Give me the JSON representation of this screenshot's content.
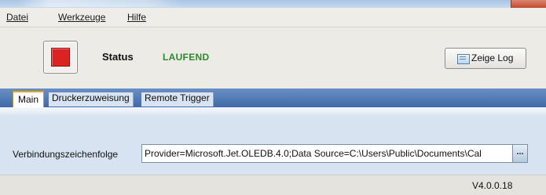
{
  "menu": {
    "items": [
      {
        "label": "Datei"
      },
      {
        "label": "Werkzeuge"
      },
      {
        "label": "Hilfe"
      }
    ]
  },
  "status": {
    "label": "Status",
    "value": "LAUFEND",
    "value_color": "#2c8a2c",
    "stop_color": "#dd2222"
  },
  "toolbar": {
    "log_button_label": "Zeige Log",
    "log_icon": "log-window-icon"
  },
  "tabs": [
    {
      "label": "Main",
      "active": true
    },
    {
      "label": "Druckerzuweisung",
      "active": false
    },
    {
      "label": "Remote Trigger",
      "active": false
    }
  ],
  "connection": {
    "label": "Verbindungszeichenfolge",
    "value": "Provider=Microsoft.Jet.OLEDB.4.0;Data Source=C:\\Users\\Public\\Documents\\Cal",
    "browse_label": "..."
  },
  "footer": {
    "version": "V4.0.0.18"
  },
  "colors": {
    "tab_strip": "#3f69a8",
    "content_bg": "#d8e3f1",
    "active_tab_border": "#e6a41e"
  }
}
